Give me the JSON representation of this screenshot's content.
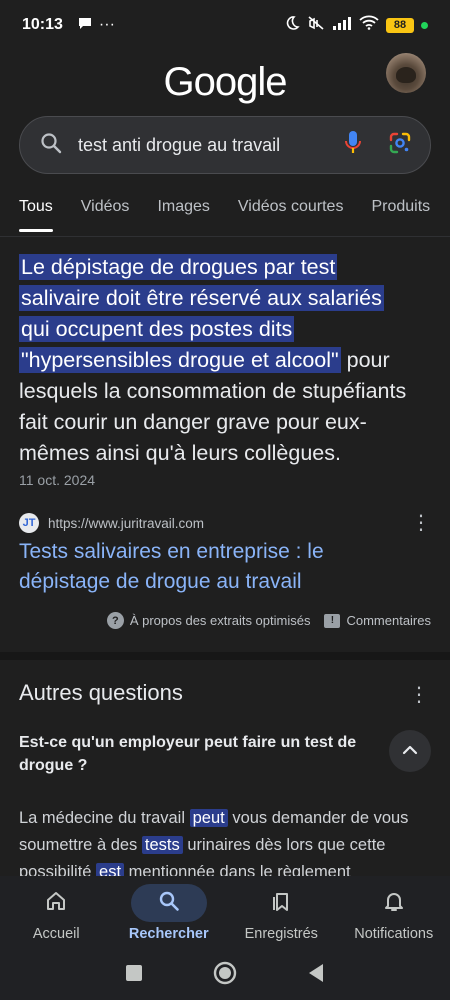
{
  "status_bar": {
    "time": "10:13",
    "ellipsis": "···",
    "battery": "88"
  },
  "header": {
    "logo": "Google"
  },
  "search": {
    "query": "test anti drogue au travail"
  },
  "tabs": [
    {
      "label": "Tous",
      "active": true
    },
    {
      "label": "Vidéos",
      "active": false
    },
    {
      "label": "Images",
      "active": false
    },
    {
      "label": "Vidéos courtes",
      "active": false
    },
    {
      "label": "Produits",
      "active": false
    }
  ],
  "snippet": {
    "highlight_lines": [
      "Le dépistage de drogues par test",
      "salivaire doit être réservé aux salariés",
      "qui occupent des postes dits",
      "\"hypersensibles drogue et alcool\""
    ],
    "rest_text": " pour lesquels la consommation de stupéfiants fait courir un danger grave pour eux-mêmes ainsi qu'à leurs collègues.",
    "date": "11 oct. 2024",
    "source_url": "https://www.juritravail.com",
    "favicon_letter": "JT",
    "title": "Tests salivaires en entreprise : le dépistage de drogue au travail",
    "about_label": "À propos des extraits optimisés",
    "feedback_label": "Commentaires"
  },
  "paa": {
    "title": "Autres questions",
    "question": "Est-ce qu'un employeur peut faire un test de drogue ?",
    "answer": {
      "p1": "La médecine du travail ",
      "kw1": "peut",
      "p2": " vous demander de vous soumettre à des ",
      "kw2": "tests",
      "p3": " urinaires dès lors que cette possibilité ",
      "kw3": "est",
      "p4": " mentionnée dans le règlement"
    }
  },
  "bottom_nav": [
    {
      "label": "Accueil",
      "icon": "home-icon",
      "active": false
    },
    {
      "label": "Rechercher",
      "icon": "search-icon",
      "active": true
    },
    {
      "label": "Enregistrés",
      "icon": "bookmarks-icon",
      "active": false
    },
    {
      "label": "Notifications",
      "icon": "bell-icon",
      "active": false
    }
  ],
  "colors": {
    "background": "#1f1f1f",
    "highlight": "#2b3d8c",
    "link": "#8ab4f8",
    "active_nav": "#a8c7fa"
  }
}
